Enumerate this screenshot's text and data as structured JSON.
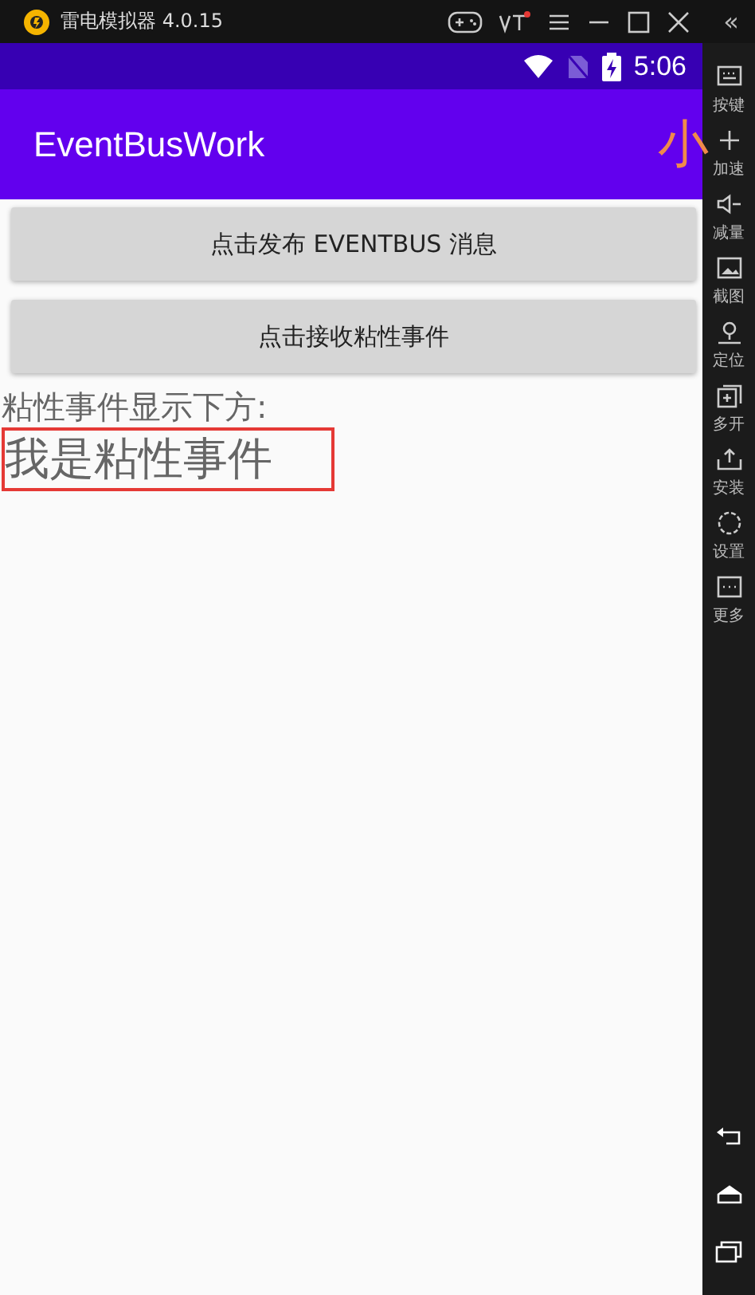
{
  "window": {
    "title": "雷电模拟器 4.0.15",
    "collapse": "«"
  },
  "status_bar": {
    "time": "5:06"
  },
  "toolbar": {
    "title": "EventBusWork",
    "overlay_text": "小"
  },
  "buttons": [
    {
      "label": "点击发布 EVENTBUS 消息"
    },
    {
      "label": "点击接收粘性事件"
    }
  ],
  "caption": "粘性事件显示下方:",
  "event_text": "我是粘性事件",
  "sidebar": {
    "items": [
      {
        "kind": "keyboard",
        "label": "按键"
      },
      {
        "kind": "speed",
        "label": "加速"
      },
      {
        "kind": "volume",
        "label": "减量"
      },
      {
        "kind": "screenshot",
        "label": "截图"
      },
      {
        "kind": "location",
        "label": "定位"
      },
      {
        "kind": "multi",
        "label": "多开"
      },
      {
        "kind": "install",
        "label": "安装"
      },
      {
        "kind": "settings",
        "label": "设置"
      },
      {
        "kind": "more",
        "label": "更多"
      }
    ]
  }
}
